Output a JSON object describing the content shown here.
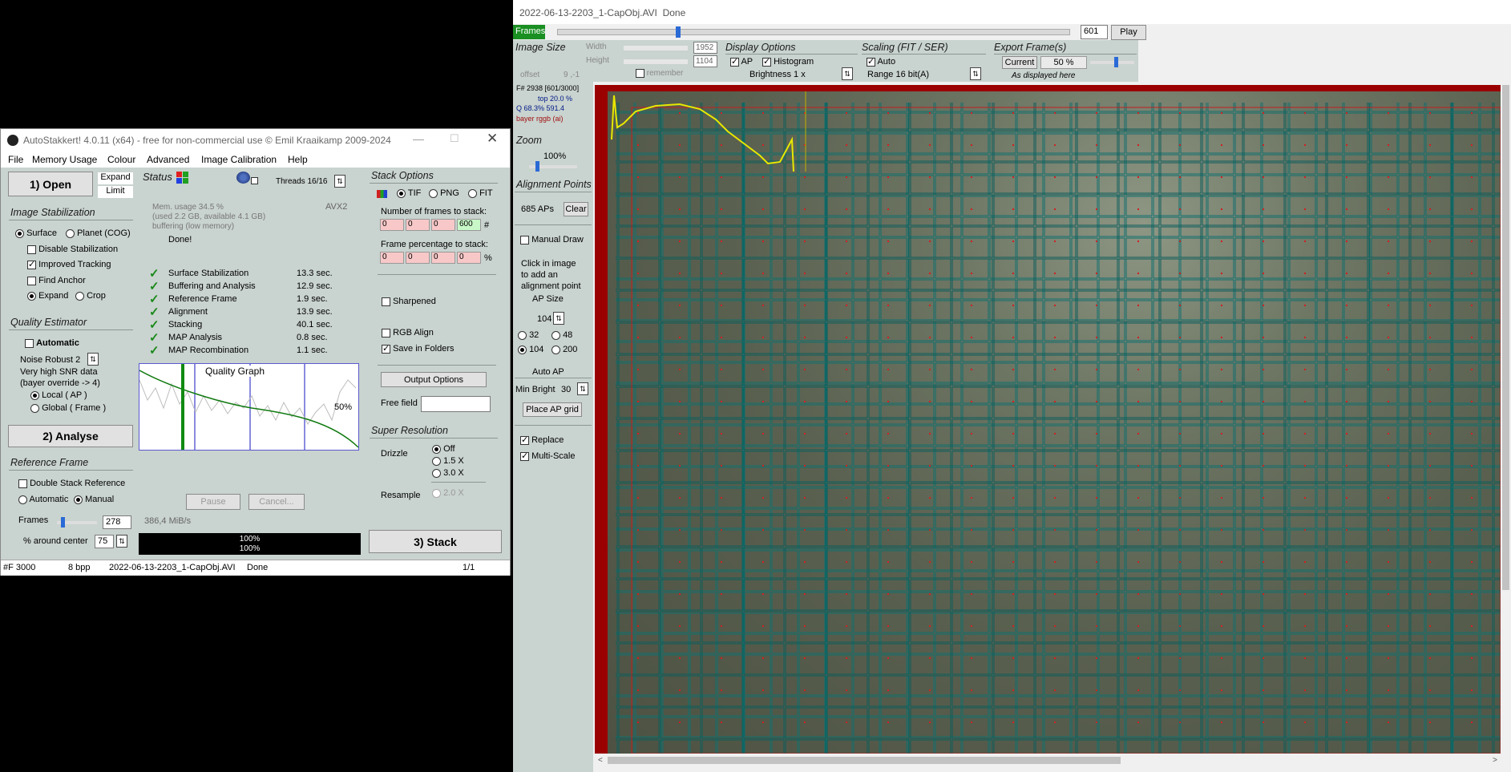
{
  "viewer": {
    "title": "2022-06-13-2203_1-CapObj.AVI",
    "status": "Done",
    "frames_tab": "Frames",
    "frame_value": "601",
    "play_label": "Play",
    "frame_pos": 0.23,
    "image_size": {
      "title": "Image Size",
      "width_label": "Width",
      "width": "1952",
      "height_label": "Height",
      "height": "1104",
      "offset_label": "offset",
      "offset": "9 ,-1",
      "remember": "remember"
    },
    "display": {
      "title": "Display Options",
      "ap": "AP",
      "histogram": "Histogram",
      "brightness": "Brightness 1 x"
    },
    "scaling": {
      "title": "Scaling (FIT / SER)",
      "auto": "Auto",
      "range": "Range 16 bit(A)"
    },
    "export": {
      "title": "Export Frame(s)",
      "current": "Current",
      "percent": "50 %",
      "note": "As displayed here"
    },
    "info": {
      "line1": "F# 2938 [601/3000]",
      "line2": "top 20.0 %",
      "line3": "Q 68.3%  591.4",
      "line4": "bayer rggb (ai)"
    },
    "zoom": {
      "title": "Zoom",
      "value": "100%"
    },
    "align": {
      "title": "Alignment Points",
      "aps": "685 APs",
      "clear": "Clear",
      "manual": "Manual Draw",
      "hint1": "Click in image",
      "hint2": "to add an",
      "hint3": "alignment point",
      "ap_size_title": "AP Size",
      "ap_size": "104",
      "s32": "32",
      "s48": "48",
      "s104": "104",
      "s200": "200",
      "auto_ap": "Auto AP",
      "min_bright_label": "Min Bright",
      "min_bright": "30",
      "place_grid": "Place AP grid",
      "replace": "Replace",
      "multiscale": "Multi-Scale"
    }
  },
  "main": {
    "title": "AutoStakkert! 4.0.11 (x64) - free for non-commercial use © Emil Kraaikamp 2009-2024",
    "menu": [
      "File",
      "Memory Usage",
      "Colour",
      "Advanced",
      "Image Calibration",
      "Help"
    ],
    "open": "1) Open",
    "expand": "Expand",
    "limit": "Limit",
    "stab": {
      "title": "Image Stabilization",
      "surface": "Surface",
      "planet": "Planet (COG)",
      "disable": "Disable Stabilization",
      "improved": "Improved Tracking",
      "anchor": "Find Anchor",
      "expand": "Expand",
      "crop": "Crop"
    },
    "quality": {
      "title": "Quality Estimator",
      "automatic": "Automatic",
      "noise": "Noise Robust  2",
      "snr": "Very high SNR data",
      "bayer": "(bayer override -> 4)",
      "local": "Local     ( AP )",
      "global": "Global    ( Frame )"
    },
    "analyse": "2) Analyse",
    "ref": {
      "title": "Reference Frame",
      "double": "Double Stack Reference",
      "automatic": "Automatic",
      "manual": "Manual",
      "frames_label": "Frames",
      "frames": "278",
      "around_label": "% around center",
      "around": "75"
    },
    "status": {
      "title": "Status",
      "threads": "Threads 16/16",
      "mem": "Mem. usage 34.5 %",
      "used": "(used 2.2 GB, available 4.1 GB)",
      "buffering": "buffering (low memory)",
      "done": "Done!",
      "avx": "AVX2",
      "steps": [
        {
          "name": "Surface Stabilization",
          "time": "13.3 sec."
        },
        {
          "name": "Buffering and Analysis",
          "time": "12.9 sec."
        },
        {
          "name": "Reference Frame",
          "time": "1.9 sec."
        },
        {
          "name": "Alignment",
          "time": "13.9 sec."
        },
        {
          "name": "Stacking",
          "time": "40.1 sec."
        },
        {
          "name": "MAP Analysis",
          "time": "0.8 sec."
        },
        {
          "name": "MAP Recombination",
          "time": "1.1 sec."
        }
      ],
      "graph_title": "Quality Graph",
      "graph_pct": "50%",
      "pause": "Pause",
      "cancel": "Cancel...",
      "speed": "386,4 MiB/s",
      "prog1": "100%",
      "prog2": "100%"
    },
    "stack": {
      "title": "Stack Options",
      "tif": "TIF",
      "png": "PNG",
      "fit": "FIT",
      "num_label": "Number of frames to stack:",
      "n": [
        "0",
        "0",
        "0",
        "600"
      ],
      "hash": "#",
      "pct_label": "Frame percentage to stack:",
      "p": [
        "0",
        "0",
        "0",
        "0"
      ],
      "pctsign": "%",
      "sharpened": "Sharpened",
      "rgb": "RGB Align",
      "folders": "Save in Folders",
      "output": "Output Options",
      "free_label": "Free field"
    },
    "sr": {
      "title": "Super Resolution",
      "drizzle": "Drizzle",
      "off": "Off",
      "x15": "1.5 X",
      "x30": "3.0 X",
      "resample": "Resample",
      "x20": "2.0 X"
    },
    "stack_btn": "3) Stack",
    "statusbar": {
      "f": "#F 3000",
      "bpp": "8 bpp",
      "file": "2022-06-13-2203_1-CapObj.AVI",
      "state": "Done",
      "page": "1/1"
    }
  }
}
